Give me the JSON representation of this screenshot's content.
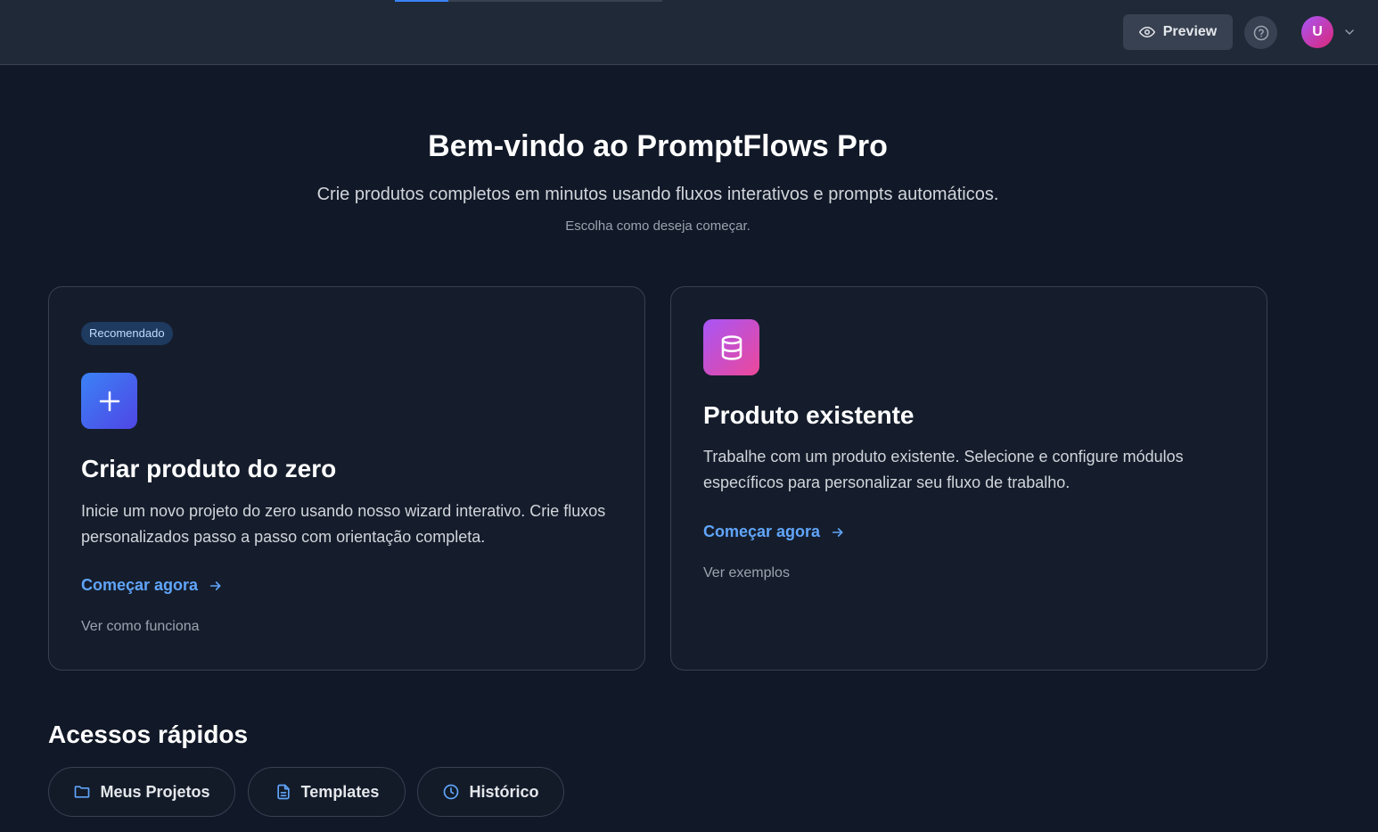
{
  "header": {
    "progress_fraction": 0.2,
    "preview_label": "Preview",
    "preview_icon": "eye-icon",
    "help_icon": "help-circle-icon",
    "avatar_initial": "U",
    "avatar_menu_icon": "chevron-down-icon"
  },
  "hero": {
    "title": "Bem-vindo ao PromptFlows Pro",
    "subtitle": "Crie produtos completos em minutos usando fluxos interativos e prompts automáticos.",
    "hint": "Escolha como deseja começar."
  },
  "cards": [
    {
      "badge": "Recomendado",
      "icon": "plus-icon",
      "title": "Criar produto do zero",
      "description": "Inicie um novo projeto do zero usando nosso wizard interativo. Crie fluxos personalizados passo a passo com orientação completa.",
      "cta": "Começar agora",
      "secondary_link": "Ver como funciona"
    },
    {
      "icon": "database-icon",
      "title": "Produto existente",
      "description": "Trabalhe com um produto existente. Selecione e configure módulos específicos para personalizar seu fluxo de trabalho.",
      "cta": "Começar agora",
      "secondary_link": "Ver exemplos"
    }
  ],
  "quick_access": {
    "title": "Acessos rápidos",
    "items": [
      {
        "label": "Meus Projetos",
        "icon": "folder-icon"
      },
      {
        "label": "Templates",
        "icon": "file-text-icon"
      },
      {
        "label": "Histórico",
        "icon": "clock-icon"
      }
    ]
  },
  "colors": {
    "background": "#111827",
    "accent": "#60a5fa",
    "card_bg": "#151d2c"
  }
}
